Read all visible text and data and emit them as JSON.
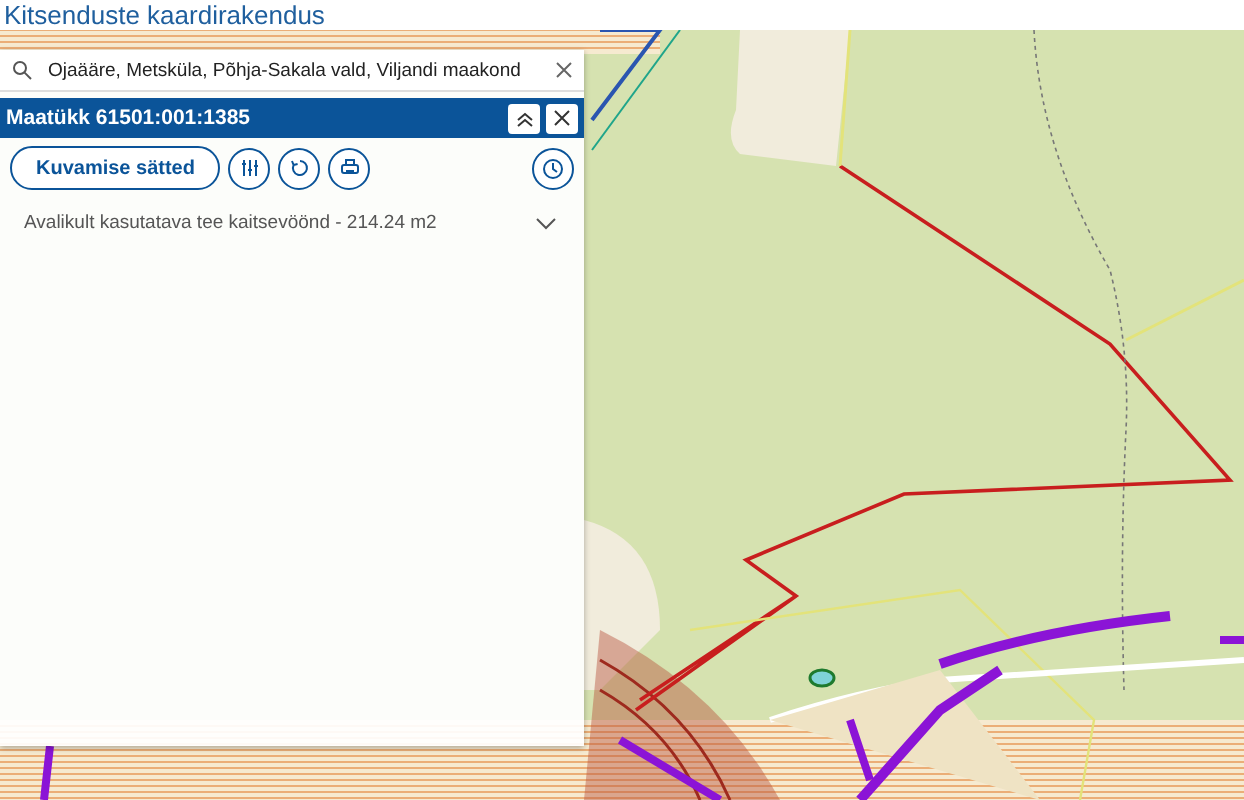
{
  "app": {
    "title": "Kitsenduste kaardirakendus"
  },
  "search": {
    "value": "Ojaääre, Metsküla, Põhja-Sakala vald, Viljandi maakond"
  },
  "panel": {
    "title": "Maatükk 61501:001:1385",
    "settings_button": "Kuvamise sätted",
    "restrictions": [
      {
        "label": "Avalikult kasutatava tee kaitsevöönd - 214.24 m2",
        "expanded": false
      }
    ]
  }
}
